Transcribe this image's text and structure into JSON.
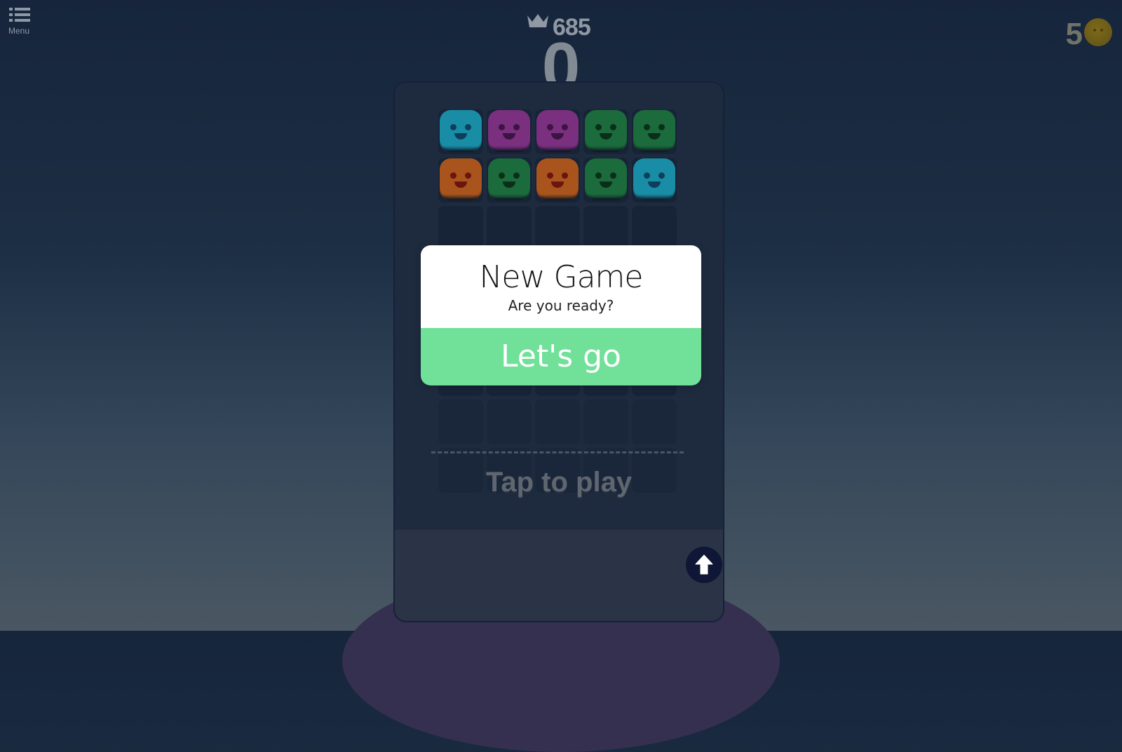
{
  "header": {
    "menu_label": "Menu",
    "menu_icon": "list-icon",
    "best_score_icon": "crown-icon",
    "best_score": "685",
    "score": "0",
    "coins": "5",
    "coin_icon": "smiley-coin-icon"
  },
  "board": {
    "columns": 5,
    "tiles": [
      {
        "row": 0,
        "col": 0,
        "color": "cyan"
      },
      {
        "row": 0,
        "col": 1,
        "color": "purple"
      },
      {
        "row": 0,
        "col": 2,
        "color": "purple"
      },
      {
        "row": 0,
        "col": 3,
        "color": "green"
      },
      {
        "row": 0,
        "col": 4,
        "color": "green"
      },
      {
        "row": 1,
        "col": 0,
        "color": "orange"
      },
      {
        "row": 1,
        "col": 1,
        "color": "green"
      },
      {
        "row": 1,
        "col": 2,
        "color": "orange"
      },
      {
        "row": 1,
        "col": 3,
        "color": "green"
      },
      {
        "row": 1,
        "col": 4,
        "color": "cyan"
      }
    ],
    "empty_rows": 6,
    "tap_label": "Tap to play",
    "up_button_icon": "up-arrow-icon"
  },
  "palette": {
    "cyan": {
      "body": "#1a8da6",
      "eye": "#0d3f5c"
    },
    "purple": {
      "body": "#7a2f7f",
      "eye": "#3b1441"
    },
    "green": {
      "body": "#1b6b3c",
      "eye": "#0b2e1a"
    },
    "orange": {
      "body": "#a9541c",
      "eye": "#6b1410"
    }
  },
  "dialog": {
    "title": "New Game",
    "subtitle": "Are you ready?",
    "button_label": "Let's go",
    "button_color": "#71e099"
  }
}
